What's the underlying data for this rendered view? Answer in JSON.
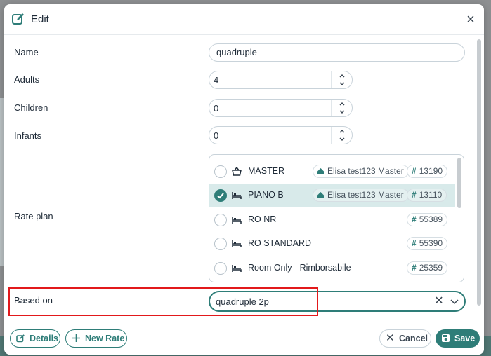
{
  "dialog": {
    "title": "Edit",
    "close_label": "×"
  },
  "form": {
    "name_label": "Name",
    "name_value": "quadruple",
    "adults_label": "Adults",
    "adults_value": "4",
    "children_label": "Children",
    "children_value": "0",
    "infants_label": "Infants",
    "infants_value": "0",
    "rate_plan_label": "Rate plan",
    "based_on_label": "Based on",
    "based_on_value": "quadruple 2p"
  },
  "rate_plans": [
    {
      "name": "MASTER",
      "icon": "basket-icon",
      "hotel": "Elisa test123 Master",
      "code": "13190",
      "selected": false
    },
    {
      "name": "PIANO B",
      "icon": "bed-icon",
      "hotel": "Elisa test123 Master",
      "code": "13110",
      "selected": true
    },
    {
      "name": "RO NR",
      "icon": "bed-icon",
      "hotel": "",
      "code": "55389",
      "selected": false
    },
    {
      "name": "RO STANDARD",
      "icon": "bed-icon",
      "hotel": "",
      "code": "55390",
      "selected": false
    },
    {
      "name": "Room Only - Rimborsabile",
      "icon": "bed-icon",
      "hotel": "",
      "code": "25359",
      "selected": false
    }
  ],
  "footer": {
    "details_label": "Details",
    "new_rate_label": "New Rate",
    "cancel_label": "Cancel",
    "save_label": "Save"
  },
  "colors": {
    "accent": "#2e7d78",
    "selected_row": "#d8eaea",
    "highlight": "#e2191b"
  }
}
